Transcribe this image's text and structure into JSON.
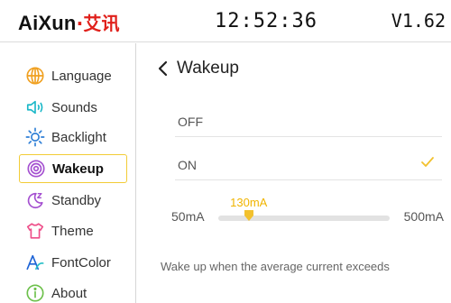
{
  "header": {
    "brand_latin": "AiXun",
    "brand_cn": "·艾讯",
    "time": "12:52:36",
    "version": "V1.62"
  },
  "sidebar": {
    "items": [
      {
        "label": "Language",
        "icon": "globe-icon"
      },
      {
        "label": "Sounds",
        "icon": "speaker-icon"
      },
      {
        "label": "Backlight",
        "icon": "sun-icon"
      },
      {
        "label": "Wakeup",
        "icon": "target-icon",
        "selected": true
      },
      {
        "label": "Standby",
        "icon": "sleep-moon-icon"
      },
      {
        "label": "Theme",
        "icon": "shirt-icon"
      },
      {
        "label": "FontColor",
        "icon": "font-color-icon"
      },
      {
        "label": "About",
        "icon": "info-icon"
      }
    ]
  },
  "main": {
    "back_glyph": "<",
    "title": "Wakeup",
    "options": [
      {
        "label": "OFF",
        "checked": false
      },
      {
        "label": "ON",
        "checked": true
      }
    ],
    "slider": {
      "min_label": "50mA",
      "max_label": "500mA",
      "value_label": "130mA",
      "min": 50,
      "max": 500,
      "value": 130
    },
    "description": "Wake up when the average current exceeds"
  },
  "colors": {
    "accent": "#f2c12e",
    "brand_red": "#e0201b",
    "globe": "#f0a020",
    "speaker": "#1bb8c8",
    "sun": "#2e7fd6",
    "target": "#a44fd0",
    "moon": "#a44fd0",
    "shirt": "#ee4f8a",
    "fontcolor": "#1e64d6",
    "info": "#6cc04a"
  }
}
